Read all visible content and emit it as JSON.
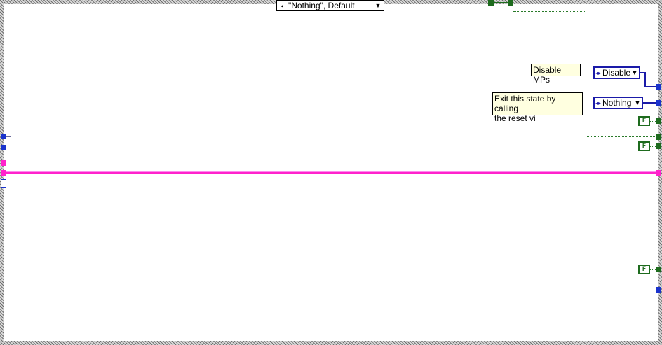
{
  "case_selector": {
    "label": "\"Nothing\", Default",
    "prev_icon": "decrement-arrow-icon",
    "next_icon": "dropdown-arrow-icon"
  },
  "comments": {
    "disable_mps": "Disable MPs",
    "exit_state_line1": "Exit this state by calling",
    "exit_state_line2": "the reset vi"
  },
  "enums": {
    "disable": {
      "value": "Disable",
      "icon": "enum-increment-icon"
    },
    "nothing": {
      "value": "Nothing",
      "icon": "enum-increment-icon"
    }
  },
  "booleans": {
    "false_label": "F"
  },
  "colors": {
    "enum_wire": "#1a1aa8",
    "boolean_wire": "#1e6b1e",
    "cluster_wire": "#ff22cc",
    "comment_bg": "#ffffe0"
  }
}
